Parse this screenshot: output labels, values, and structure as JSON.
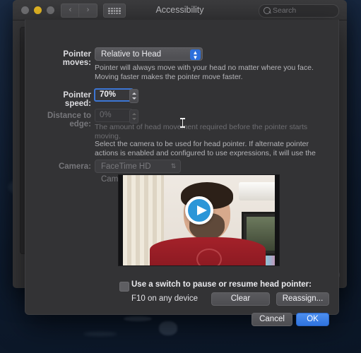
{
  "window": {
    "title": "Accessibility",
    "traffic_lights": [
      "close",
      "minimize",
      "maximize"
    ],
    "nav_back": "‹",
    "nav_forward": "›",
    "grid_button": "show-all-icon",
    "help_label": "?"
  },
  "search": {
    "placeholder": "Search",
    "value": ""
  },
  "sheet": {
    "pointer_moves": {
      "label": "Pointer moves:",
      "value": "Relative to Head"
    },
    "pointer_moves_description": "Pointer will always move with your head no matter where you face. Moving faster makes the pointer move faster.",
    "pointer_speed": {
      "label": "Pointer speed:",
      "value": "70%"
    },
    "distance_to_edge": {
      "label": "Distance to edge:",
      "value": "0%"
    },
    "distance_description": "The amount of head movement required before the pointer starts moving.",
    "camera_description": "Select the camera to be used for head pointer. If alternate pointer actions is enabled and configured to use expressions, it will use the same camera.",
    "camera": {
      "label": "Camera:",
      "value": "FaceTime HD Camera"
    },
    "video": {
      "play_label": "play-button"
    },
    "switch_checkbox": {
      "label": "Use a switch to pause or resume head pointer:",
      "checked": false
    },
    "shortcut": "F10 on any device",
    "clear_button": "Clear",
    "reassign_button": "Reassign...",
    "cancel_button": "Cancel",
    "ok_button": "OK"
  },
  "colors": {
    "accent_blue": "#2d6fdb",
    "primary_button": "#3b7ce4",
    "sheet_bg": "#333335",
    "window_bg": "#363638",
    "desktop": "#14233a"
  }
}
